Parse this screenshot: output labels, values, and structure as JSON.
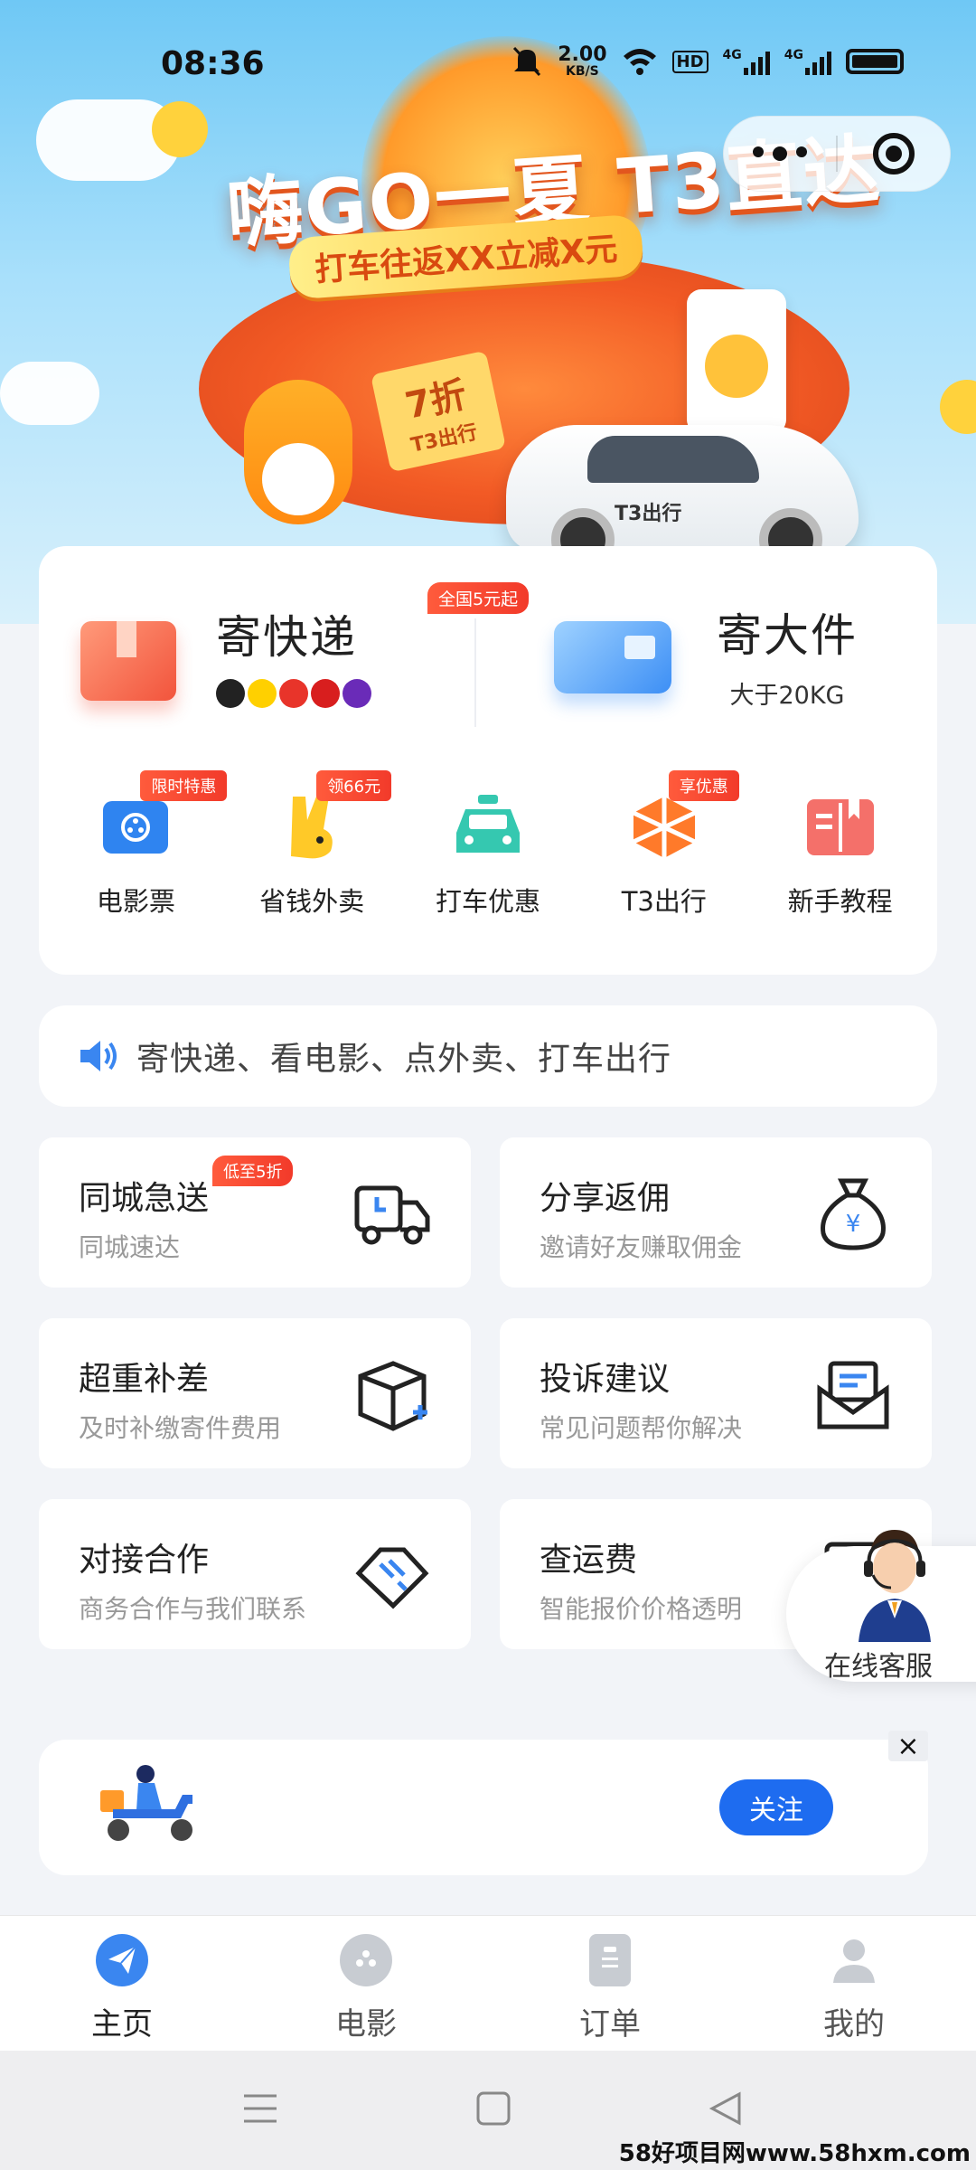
{
  "status_bar": {
    "time": "08:36",
    "net_speed_value": "2.00",
    "net_speed_unit": "KB/S",
    "hd": "HD",
    "sig1": "4G",
    "sig2": "4G"
  },
  "banner": {
    "headline": "嗨GO一夏 T3直达",
    "subline": "打车往返XX立减X元",
    "ticket": "7折",
    "ticket_sub": "T3出行",
    "car_logo": "T3出行"
  },
  "services": [
    {
      "title": "寄快递",
      "tag": "全国5元起"
    },
    {
      "title": "寄大件",
      "sub": "大于20KG"
    }
  ],
  "quick_entries": [
    {
      "label": "电影票",
      "tag": "限时特惠"
    },
    {
      "label": "省钱外卖",
      "tag": "领66元"
    },
    {
      "label": "打车优惠",
      "tag": ""
    },
    {
      "label": "T3出行",
      "tag": "享优惠"
    },
    {
      "label": "新手教程",
      "tag": ""
    }
  ],
  "notice": {
    "text": "寄快递、看电影、点外卖、打车出行"
  },
  "tiles": [
    {
      "title": "同城急送",
      "sub": "同城速达",
      "tag": "低至5折"
    },
    {
      "title": "分享返佣",
      "sub": "邀请好友赚取佣金"
    },
    {
      "title": "超重补差",
      "sub": "及时补缴寄件费用"
    },
    {
      "title": "投诉建议",
      "sub": "常见问题帮你解决"
    },
    {
      "title": "对接合作",
      "sub": "商务合作与我们联系"
    },
    {
      "title": "查运费",
      "sub": "智能报价价格透明"
    }
  ],
  "customer_service": {
    "label": "在线客服"
  },
  "follow_bar": {
    "button": "关注",
    "close": "×"
  },
  "tabbar": [
    {
      "label": "主页",
      "icon": "paper-plane-icon",
      "active": true
    },
    {
      "label": "电影",
      "icon": "film-reel-icon",
      "active": false
    },
    {
      "label": "订单",
      "icon": "clipboard-icon",
      "active": false
    },
    {
      "label": "我的",
      "icon": "person-icon",
      "active": false
    }
  ],
  "watermark": "58好项目网www.58hxm.com",
  "colors": {
    "accent_blue": "#1e6cf0",
    "tag_red": "#f23a2a",
    "background": "#f2f4f8"
  }
}
